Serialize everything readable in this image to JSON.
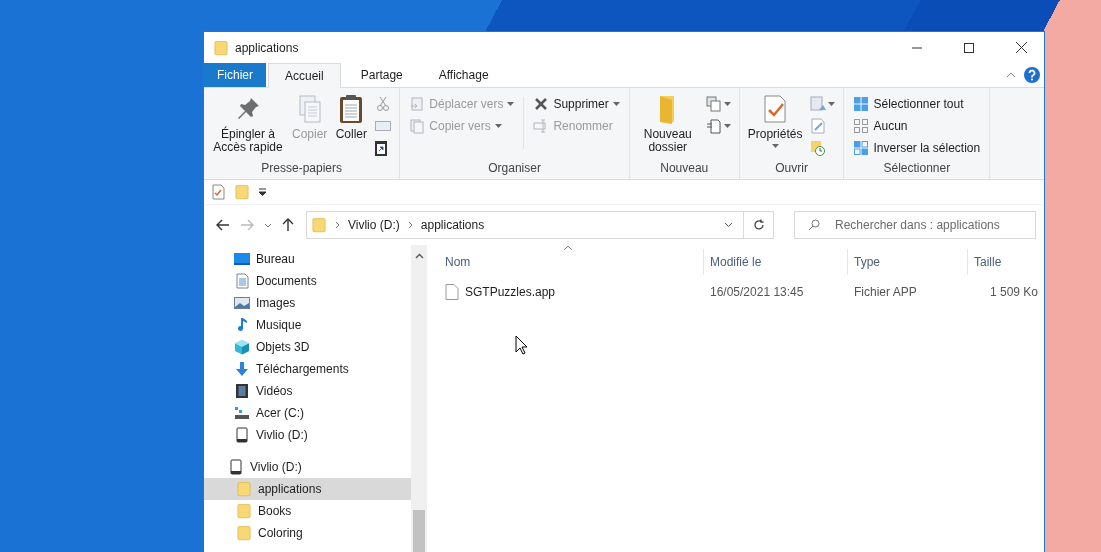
{
  "window": {
    "title": "applications"
  },
  "ribbon_tabs": [
    {
      "label": "Fichier",
      "kind": "file",
      "selected": false
    },
    {
      "label": "Accueil",
      "kind": "tab",
      "selected": true
    },
    {
      "label": "Partage",
      "kind": "tab",
      "selected": false
    },
    {
      "label": "Affichage",
      "kind": "tab",
      "selected": false
    }
  ],
  "ribbon_groups": [
    {
      "label": "Presse-papiers",
      "buttons": [
        {
          "label": "Épingler à Accès rapide",
          "kind": "pin",
          "disabled": false
        },
        {
          "label": "Copier",
          "kind": "copy",
          "disabled": true
        },
        {
          "label": "Coller",
          "kind": "paste",
          "disabled": false
        }
      ]
    },
    {
      "label": "Organiser",
      "buttons": [
        {
          "label": "Déplacer vers",
          "kind": "move",
          "disabled": true
        },
        {
          "label": "Copier vers",
          "kind": "copyto",
          "disabled": true
        },
        {
          "label": "Supprimer",
          "kind": "delete",
          "disabled": false
        },
        {
          "label": "Renommer",
          "kind": "rename",
          "disabled": true
        }
      ]
    },
    {
      "label": "Nouveau",
      "buttons": [
        {
          "label": "Nouveau dossier",
          "kind": "newfolder",
          "disabled": false
        }
      ]
    },
    {
      "label": "Ouvrir",
      "buttons": [
        {
          "label": "Propriétés",
          "kind": "properties",
          "disabled": false
        }
      ]
    },
    {
      "label": "Sélectionner",
      "buttons": [
        {
          "label": "Sélectionner tout",
          "kind": "selectall",
          "disabled": false
        },
        {
          "label": "Aucun",
          "kind": "selectnone",
          "disabled": false
        },
        {
          "label": "Inverser la sélection",
          "kind": "invert",
          "disabled": false
        }
      ]
    }
  ],
  "address": {
    "breadcrumbs": [
      "Vivlio (D:)",
      "applications"
    ]
  },
  "search": {
    "placeholder": "Rechercher dans : applications"
  },
  "nav": [
    {
      "label": "Bureau",
      "kind": "desktop",
      "selected": false
    },
    {
      "label": "Documents",
      "kind": "documents",
      "selected": false
    },
    {
      "label": "Images",
      "kind": "pictures",
      "selected": false
    },
    {
      "label": "Musique",
      "kind": "music",
      "selected": false
    },
    {
      "label": "Objets 3D",
      "kind": "objects",
      "selected": false
    },
    {
      "label": "Téléchargements",
      "kind": "downloads",
      "selected": false
    },
    {
      "label": "Vidéos",
      "kind": "videos",
      "selected": false
    },
    {
      "label": "Acer (C:)",
      "kind": "drive",
      "selected": false
    },
    {
      "label": "Vivlio (D:)",
      "kind": "device",
      "selected": false
    },
    {
      "label": "Vivlio (D:)",
      "kind": "device",
      "selected": false,
      "children": [
        {
          "label": "applications",
          "kind": "folder",
          "selected": true
        },
        {
          "label": "Books",
          "kind": "folder",
          "selected": false
        },
        {
          "label": "Coloring",
          "kind": "folder",
          "selected": false
        }
      ]
    }
  ],
  "table": {
    "columns": [
      "Nom",
      "Modifié le",
      "Type",
      "Taille"
    ],
    "rows": [
      {
        "cells": [
          "SGTPuzzles.app",
          "16/05/2021 13:45",
          "Fichier APP",
          "1 509 Ko"
        ],
        "selected": false
      }
    ]
  }
}
